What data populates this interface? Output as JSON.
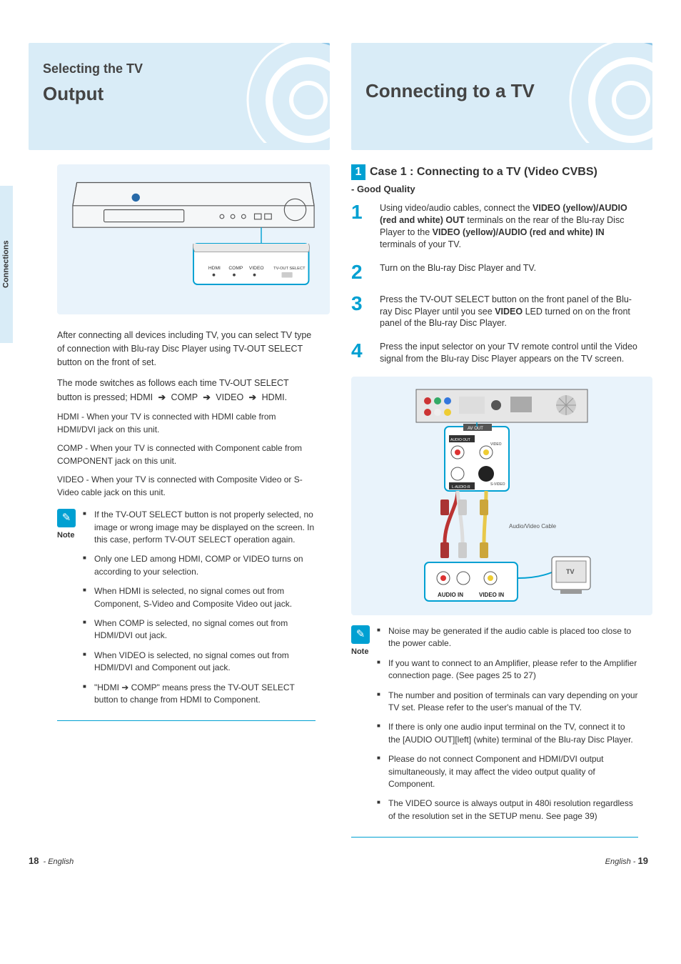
{
  "sidebarLabel": "Connections",
  "left": {
    "banner": {
      "line1": "Selecting the TV",
      "line2": "Output"
    },
    "intro": "After connecting all devices including TV, you can select TV type of connection with Blu-ray Disc Player using TV-OUT SELECT button on the front of set.",
    "seqPrefix": "The mode switches as follows each time TV-OUT SELECT button is pressed; HDMI",
    "seqItems": [
      "COMP",
      "VIDEO",
      "HDMI."
    ],
    "hdmiLine": "HDMI - When your TV is connected with HDMI cable from HDMI/DVI jack on this unit.",
    "compLine": "COMP - When your TV is connected with Component cable from COMPONENT jack on this unit.",
    "videoLine": "VIDEO - When your TV is connected with Composite Video or S-Video cable jack on this unit.",
    "noteLabel": "Note",
    "notes": [
      "If the TV-OUT SELECT button is not properly selected, no image or wrong image may be displayed on the screen. In this case, perform TV-OUT SELECT operation again.",
      "Only one LED among HDMI, COMP or VIDEO turns on according to your selection.",
      "When HDMI is selected, no signal comes out from Component, S-Video and Composite Video out jack.",
      "When COMP is selected, no signal comes out from HDMI/DVI out jack.",
      "When VIDEO is selected, no signal comes out from HDMI/DVI and Component out jack.",
      "\"HDMI ➔ COMP\" means press the TV-OUT SELECT button to change from HDMI to Component."
    ],
    "panelLabels": {
      "hdmi": "HDMI",
      "comp": "COMP",
      "video": "VIDEO",
      "tvOut": "TV-OUT SELECT"
    }
  },
  "right": {
    "banner": {
      "single": "Connecting to a TV"
    },
    "caseNumber": "1",
    "caseTitle": "Case 1 : Connecting to a TV (Video CVBS)",
    "caseSub": "- Good Quality",
    "steps": [
      {
        "n": "1",
        "head": "Using video/audio cables, connect the <b>VIDEO (yellow)/AUDIO<br/>(red and white) OUT</b> terminals on the rear of the Blu-ray Disc Player to the <b>VIDEO (yellow)/AUDIO (red and white) IN</b> terminals of your TV."
      },
      {
        "n": "2",
        "head": "Turn on the Blu-ray Disc Player and TV."
      },
      {
        "n": "3",
        "head": "Press the TV-OUT SELECT button on the front panel of the Blu-ray Disc Player until you see <b>VIDEO</b> LED turned on on the front panel of the Blu-ray Disc Player."
      },
      {
        "n": "4",
        "head": "Press the input selector on your TV remote control until the Video signal from the Blu-ray Disc Player appears on the TV screen."
      }
    ],
    "wiring": {
      "avOut": "AV OUT",
      "audioOutLabel": "AUDIO OUT",
      "audioLR": "L-AUDIO-R",
      "videoLabel": "VIDEO",
      "svideoLabel": "S-VIDEO",
      "audioIn": "AUDIO IN",
      "videoIn": "VIDEO IN",
      "tv": "TV",
      "cable": "Audio/Video Cable"
    },
    "noteLabel": "Note",
    "notes": [
      "Noise may be generated if the audio cable is placed too close to the power cable.",
      "If you want to connect to an Amplifier, please refer to the Amplifier connection page. (See pages 25 to 27)",
      "The number and position of terminals can vary depending on your TV set. Please refer to the user's manual of the TV.",
      "If there is only one audio input terminal on the TV, connect it to the [AUDIO OUT][left] (white) terminal of the Blu-ray Disc Player.",
      "Please do not connect Component and HDMI/DVI output simultaneously, it may affect the video output quality of Component.",
      "The VIDEO source is always output in 480i resolution regardless of the resolution set in the SETUP menu. See page 39)"
    ]
  },
  "pageLeft": {
    "n": "18",
    "t": "- English"
  },
  "pageRight": {
    "t": "English - ",
    "n": "19"
  }
}
